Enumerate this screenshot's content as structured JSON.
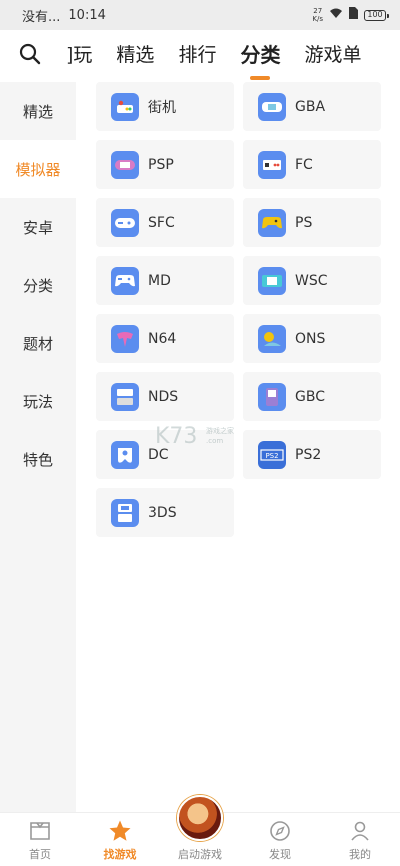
{
  "status_bar": {
    "carrier": "没有...",
    "time": "10:14",
    "speed_top": "27",
    "speed_bottom": "K/s",
    "battery": "100"
  },
  "top_nav": {
    "tabs": [
      {
        "label": "]玩"
      },
      {
        "label": "精选"
      },
      {
        "label": "排行"
      },
      {
        "label": "分类"
      },
      {
        "label": "游戏单"
      }
    ],
    "active_tab": "分类"
  },
  "sidebar": {
    "items": [
      {
        "label": "精选"
      },
      {
        "label": "模拟器"
      },
      {
        "label": "安卓"
      },
      {
        "label": "分类"
      },
      {
        "label": "题材"
      },
      {
        "label": "玩法"
      },
      {
        "label": "特色"
      }
    ],
    "active_item": "模拟器"
  },
  "emulators": [
    {
      "label": "街机",
      "icon": "arcade-icon"
    },
    {
      "label": "GBA",
      "icon": "gba-icon"
    },
    {
      "label": "PSP",
      "icon": "psp-icon"
    },
    {
      "label": "FC",
      "icon": "fc-icon"
    },
    {
      "label": "SFC",
      "icon": "sfc-icon"
    },
    {
      "label": "PS",
      "icon": "ps-icon"
    },
    {
      "label": "MD",
      "icon": "md-icon"
    },
    {
      "label": "WSC",
      "icon": "wsc-icon"
    },
    {
      "label": "N64",
      "icon": "n64-icon"
    },
    {
      "label": "ONS",
      "icon": "ons-icon"
    },
    {
      "label": "NDS",
      "icon": "nds-icon"
    },
    {
      "label": "GBC",
      "icon": "gbc-icon"
    },
    {
      "label": "DC",
      "icon": "dc-icon"
    },
    {
      "label": "PS2",
      "icon": "ps2-icon"
    },
    {
      "label": "3DS",
      "icon": "3ds-icon"
    }
  ],
  "bottom_nav": {
    "items": [
      {
        "label": "首页"
      },
      {
        "label": "找游戏"
      },
      {
        "label": "启动游戏"
      },
      {
        "label": "发现"
      },
      {
        "label": "我的"
      }
    ],
    "active_item": "找游戏"
  },
  "colors": {
    "accent": "#f08a28",
    "icon_blue": "#5b8def",
    "sidebar_bg": "#f5f5f5",
    "card_bg": "#f6f6f6"
  },
  "watermark": {
    "text": "K73"
  }
}
